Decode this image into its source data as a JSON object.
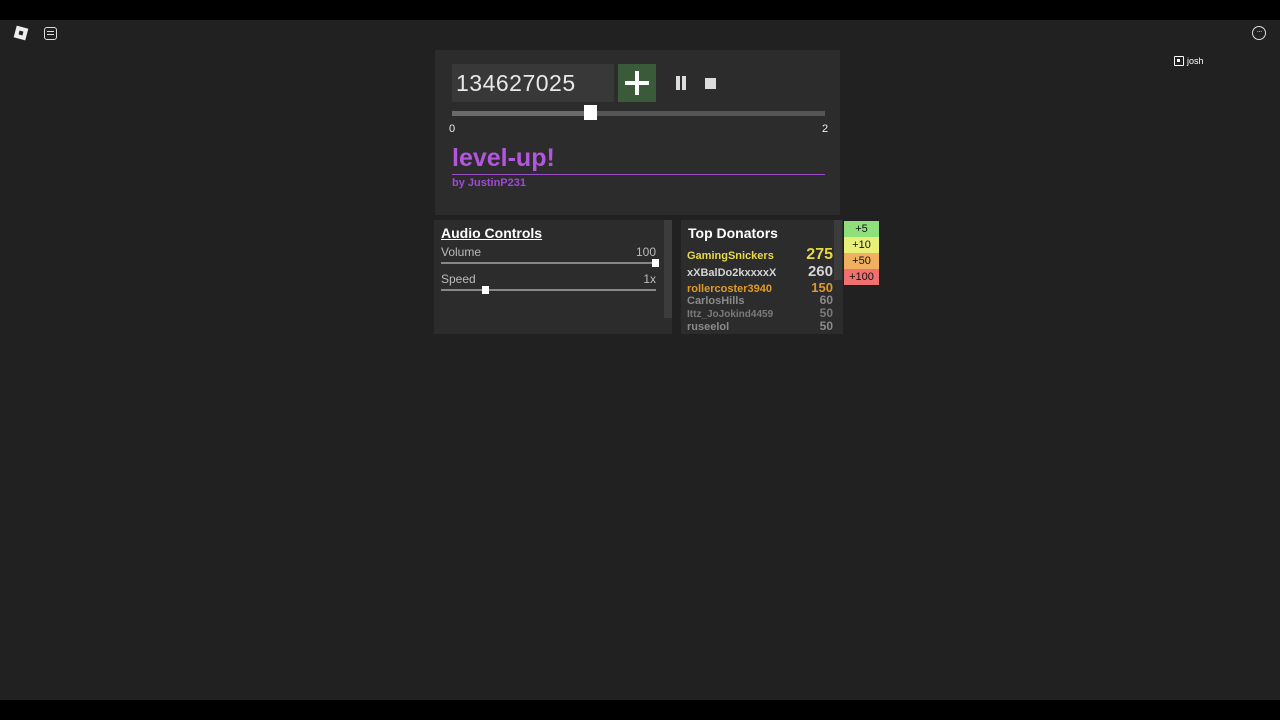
{
  "player": {
    "sound_id": "134627025",
    "seek": {
      "min": "0",
      "max": "2",
      "position_fraction": 0.37
    },
    "song_title": "level-up!",
    "song_artist": "by JustinP231"
  },
  "audio_controls": {
    "title": "Audio Controls",
    "volume": {
      "label": "Volume",
      "value": "100",
      "level": 1.0
    },
    "speed": {
      "label": "Speed",
      "value": "1x",
      "level": 0.21
    }
  },
  "top_donators": {
    "title": "Top Donators",
    "rows": [
      {
        "name": "GamingSnickers",
        "amount": "275",
        "color": "#e8d84a",
        "size": 11,
        "amount_size": 16
      },
      {
        "name": "xXBalDo2kxxxxX",
        "amount": "260",
        "color": "#d4d4d4",
        "size": 11,
        "amount_size": 15
      },
      {
        "name": "rollercoster3940",
        "amount": "150",
        "color": "#e09a2a",
        "size": 11,
        "amount_size": 13
      },
      {
        "name": "CarlosHills",
        "amount": "60",
        "color": "#8a8a8a",
        "size": 11,
        "amount_size": 12
      },
      {
        "name": "Ittz_JoJokind4459",
        "amount": "50",
        "color": "#7a7a7a",
        "size": 10,
        "amount_size": 12
      },
      {
        "name": "ruseelol",
        "amount": "50",
        "color": "#8a8a8a",
        "size": 11,
        "amount_size": 12
      }
    ]
  },
  "donate_buttons": [
    {
      "label": "+5",
      "color": "#8fe07a"
    },
    {
      "label": "+10",
      "color": "#e8f07a"
    },
    {
      "label": "+50",
      "color": "#f0b060"
    },
    {
      "label": "+100",
      "color": "#f07070"
    }
  ],
  "topbar": {
    "username": "josh"
  }
}
